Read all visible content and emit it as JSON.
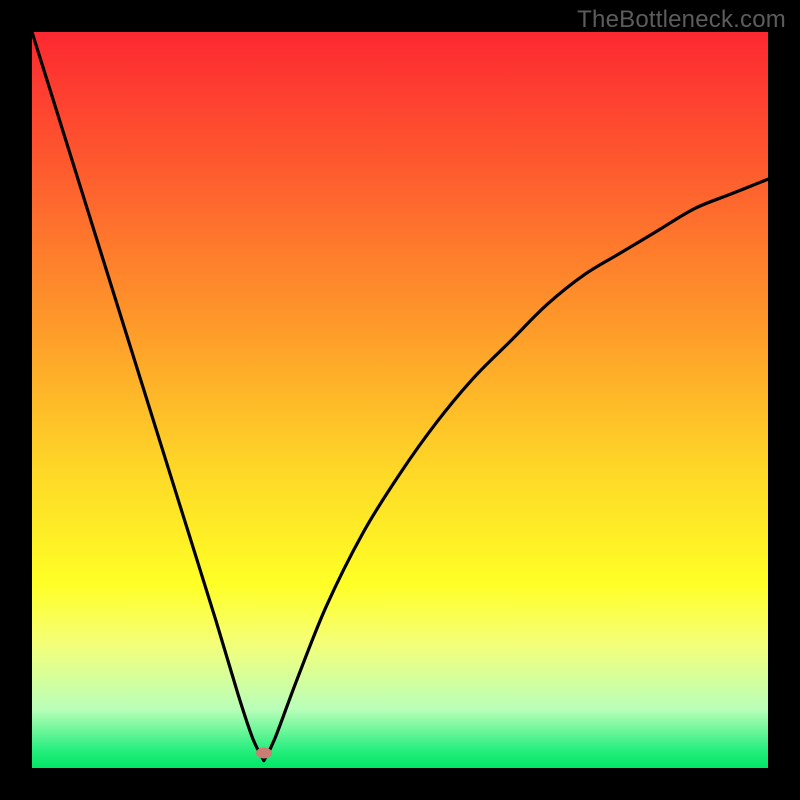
{
  "watermark": {
    "text": "TheBottleneck.com"
  },
  "axes": {
    "x": {
      "min": 0,
      "max": 100
    },
    "y": {
      "min": 0,
      "max": 100
    }
  },
  "gradient_stops": [
    {
      "pos": 0,
      "color": "#FD2831"
    },
    {
      "pos": 0.2,
      "color": "#FE5F2E"
    },
    {
      "pos": 0.4,
      "color": "#FE9A2A"
    },
    {
      "pos": 0.6,
      "color": "#FED927"
    },
    {
      "pos": 0.75,
      "color": "#FFFF26"
    },
    {
      "pos": 0.83,
      "color": "#F5FF77"
    },
    {
      "pos": 0.92,
      "color": "#B9FFB9"
    },
    {
      "pos": 0.975,
      "color": "#29EE7F"
    },
    {
      "pos": 1.0,
      "color": "#00E765"
    }
  ],
  "marker": {
    "x_pct": 31.5,
    "y_pct": 98.0,
    "color": "#CB7D74"
  },
  "chart_data": {
    "type": "line",
    "title": "",
    "xlabel": "",
    "ylabel": "",
    "xlim": [
      0,
      100
    ],
    "ylim": [
      0,
      100
    ],
    "curve": {
      "description": "V-shaped bottleneck curve; minimum near x≈31.5. Left branch falls steeply from near 100 at x=0 to ~0 at x≈31.5. Right branch rises with diminishing slope toward ~80 at x=100.",
      "x": [
        0,
        5,
        10,
        15,
        20,
        25,
        28,
        30,
        31.5,
        33,
        36,
        40,
        45,
        50,
        55,
        60,
        65,
        70,
        75,
        80,
        85,
        90,
        95,
        100
      ],
      "y": [
        100,
        84,
        68,
        52,
        36,
        20,
        10,
        4,
        1,
        4,
        12,
        22,
        32,
        40,
        47,
        53,
        58,
        63,
        67,
        70,
        73,
        76,
        78,
        80
      ]
    },
    "marker_point": {
      "x": 31.5,
      "y": 1
    }
  }
}
